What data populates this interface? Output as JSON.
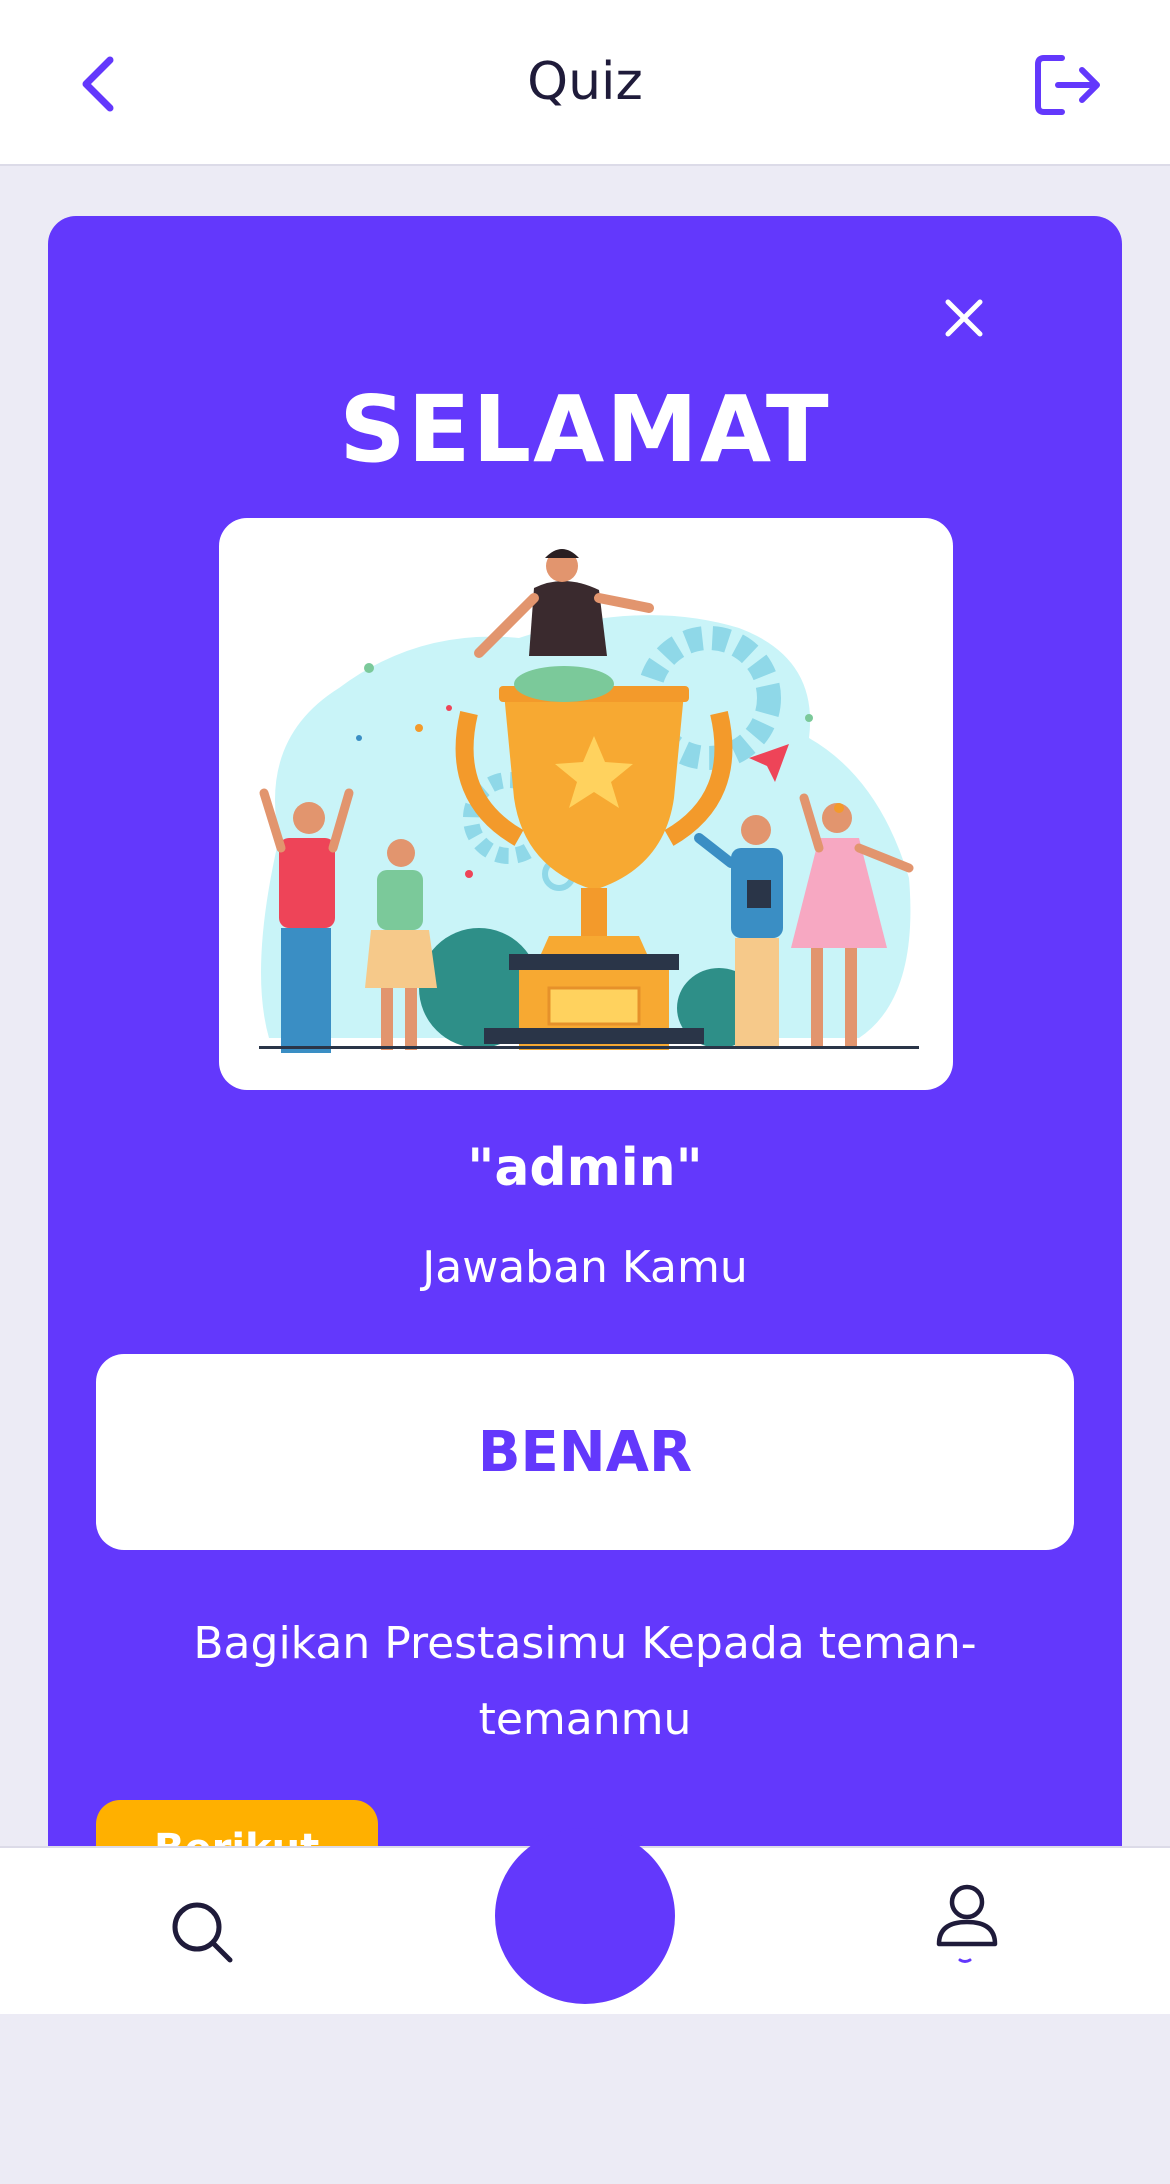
{
  "header": {
    "title": "Quiz",
    "back_icon": "chevron-left-icon",
    "logout_icon": "logout-icon"
  },
  "result_card": {
    "close_icon": "close-icon",
    "heading": "SELAMAT",
    "illustration": "trophy-celebration-illustration",
    "username": "\"admin\"",
    "answer_label": "Jawaban Kamu",
    "result": "BENAR",
    "share_text": "Bagikan Prestasimu Kepada teman-temanmu",
    "next_button_label": "Berikut"
  },
  "bottom_nav": {
    "items": [
      {
        "icon": "search-icon"
      },
      {
        "icon": "home-center-button"
      },
      {
        "icon": "user-icon"
      }
    ]
  },
  "colors": {
    "primary": "#6338FC",
    "accent": "#FFB000",
    "background": "#ECEBF5",
    "white": "#FFFFFF",
    "text_dark": "#1F1B3A"
  }
}
